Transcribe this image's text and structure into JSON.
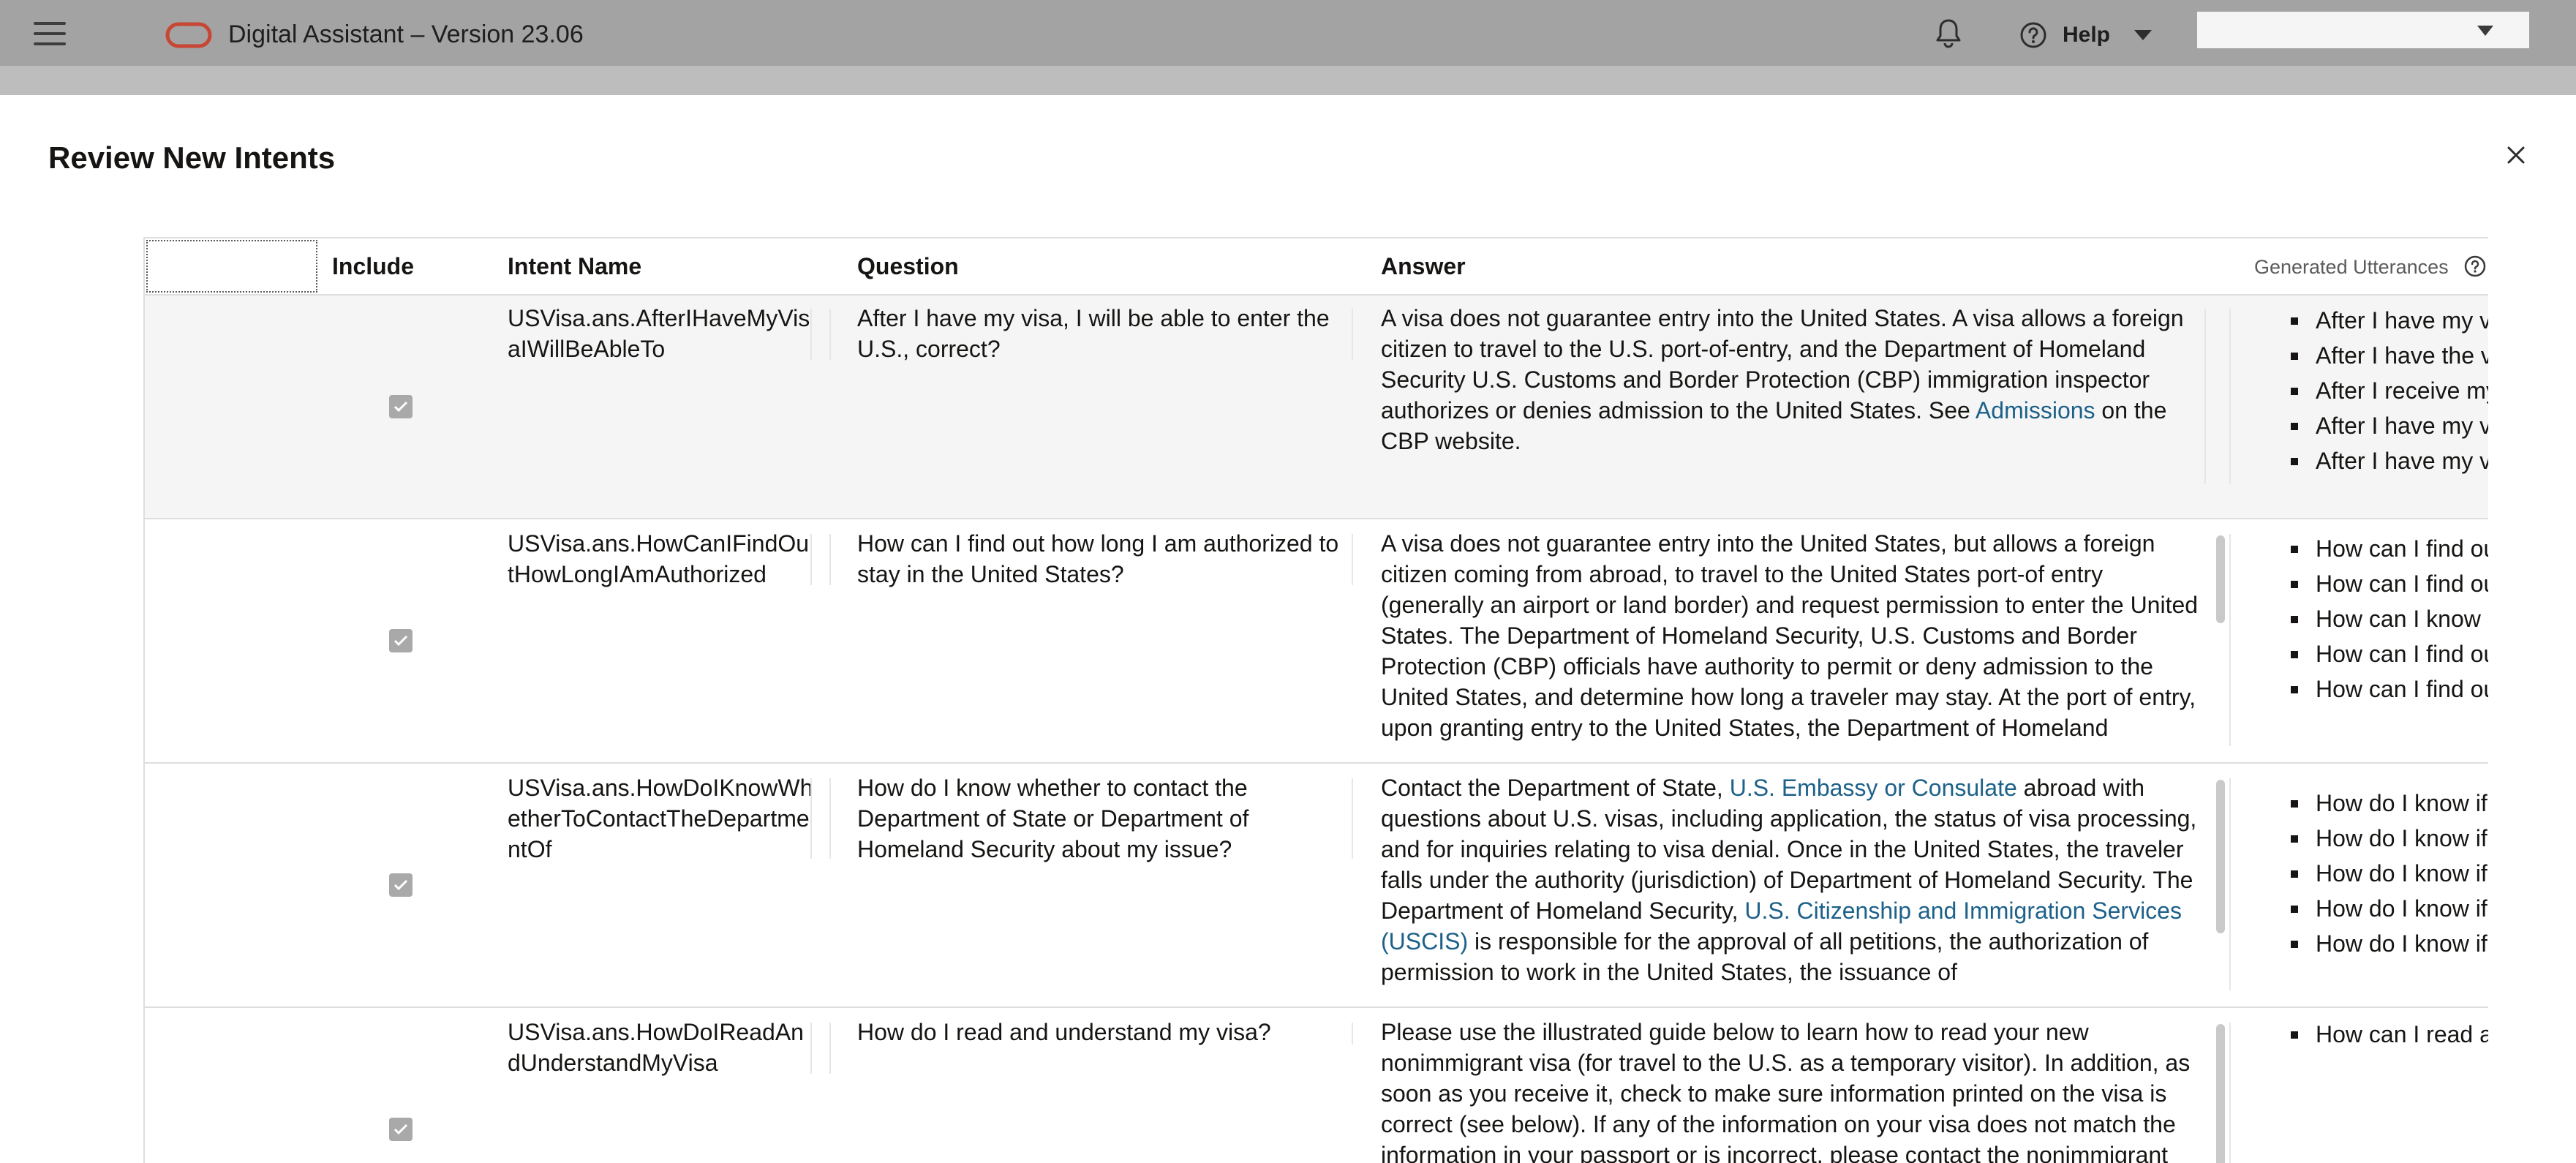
{
  "app": {
    "title": "Digital Assistant – Version 23.06",
    "help_label": "Help"
  },
  "dialog": {
    "title": "Review New Intents"
  },
  "table": {
    "columns": {
      "include": "Include",
      "intent_name": "Intent Name",
      "question": "Question",
      "answer": "Answer",
      "generated_utterances": "Generated Utterances"
    },
    "rows": [
      {
        "included": true,
        "intent_name": "USVisa.ans.AfterIHaveMyVisaIWillBeAbleTo",
        "question": "After I have my visa, I will be able to enter the U.S., correct?",
        "answer_parts": [
          "A visa does not guarantee entry into the United States. A visa allows a foreign citizen to travel to the U.S. port-of-entry, and the Department of Homeland Security U.S. Customs and Border Protection (CBP) immigration inspector authorizes or denies admission to the United States. See ",
          "Admissions",
          " on the CBP website."
        ],
        "utterances": [
          "After I have my v",
          "After I have the v",
          "After I receive my",
          "After I have my v",
          "After I have my v"
        ]
      },
      {
        "included": true,
        "intent_name": "USVisa.ans.HowCanIFindOutHowLongIAmAuthorized",
        "question": "How can I find out how long I am authorized to stay in the United States?",
        "answer": "A visa does not guarantee entry into the United States, but allows a foreign citizen coming from abroad, to travel to the United States port-of entry (generally an airport or land border) and request permission to enter the United States. The Department of Homeland Security, U.S. Customs and Border Protection (CBP) officials have authority to permit or deny admission to the United States, and determine how long a traveler may stay. At the port of entry, upon granting entry to the United States, the Department of Homeland",
        "utterances": [
          "How can I find ou",
          "How can I find ou",
          "How can I know h",
          "How can I find ou",
          "How can I find ou"
        ]
      },
      {
        "included": true,
        "intent_name": "USVisa.ans.HowDoIKnowWhetherToContactTheDepartmentOf",
        "question": "How do I know whether to contact the Department of State or Department of Homeland Security about my issue?",
        "answer_parts": [
          "Contact the Department of State, ",
          "U.S. Embassy or Consulate",
          " abroad with questions about U.S. visas, including application, the status of visa processing, and for inquiries relating to visa denial. Once in the United States, the traveler falls under the authority (jurisdiction) of Department of Homeland Security. The Department of Homeland Security, ",
          "U.S. Citizenship and Immigration Services (USCIS)",
          " is responsible for the approval of all petitions, the authorization of permission to work in the United States, the issuance of"
        ],
        "utterances": [
          "How do I know if",
          "How do I know if",
          "How do I know if",
          "How do I know if",
          "How do I know if"
        ]
      },
      {
        "included": true,
        "intent_name": "USVisa.ans.HowDoIReadAndUnderstandMyVisa",
        "question": "How do I read and understand my visa?",
        "answer": "Please use the illustrated guide below to learn how to read your new nonimmigrant visa (for travel to the U.S. as a temporary visitor). In addition, as soon as you receive it, check to make sure information printed on the visa is correct (see below). If any of the information on your visa does not match the information in your passport or is incorrect, please contact the nonimmigrant",
        "utterances": [
          "How can I read a"
        ]
      }
    ]
  },
  "icons": {
    "menu": "hamburger-menu-icon",
    "logo": "oracle-logo",
    "notifications": "bell-icon",
    "help": "help-circle-icon",
    "close": "close-icon",
    "info": "info-circle-icon",
    "checkbox": "checkbox-checked-icon"
  },
  "colors": {
    "appbar": "#a3a3a3",
    "logo_red": "#c74634",
    "link": "#1d6189",
    "checkbox_disabled": "#a9a9a9",
    "first_row_bg": "#f5f5f5"
  }
}
